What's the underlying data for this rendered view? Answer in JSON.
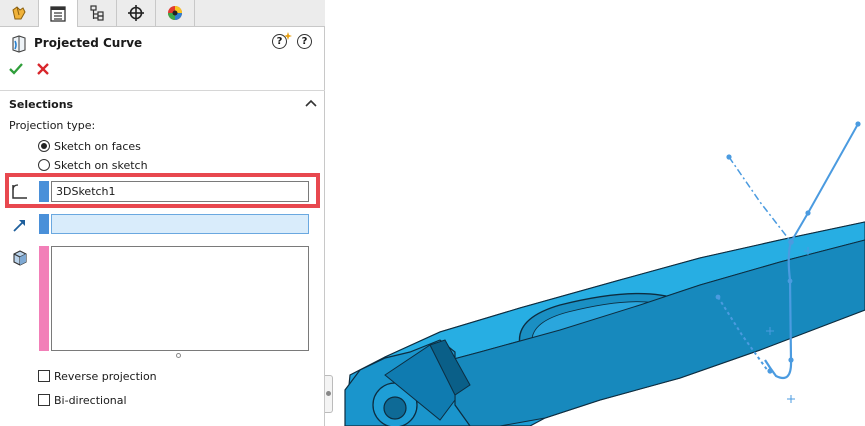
{
  "tabs": [
    {
      "icon": "feature-manager-icon",
      "active": false
    },
    {
      "icon": "property-manager-icon",
      "active": true
    },
    {
      "icon": "configuration-manager-icon",
      "active": false
    },
    {
      "icon": "dimxpert-manager-icon",
      "active": false
    },
    {
      "icon": "display-manager-icon",
      "active": false
    }
  ],
  "header": {
    "title": "Projected Curve",
    "title_icon": "projected-curve-icon",
    "help_label": "?"
  },
  "actions": {
    "ok_icon": "checkmark-icon",
    "cancel_icon": "x-icon"
  },
  "selections": {
    "section_title": "Selections",
    "projection_type_label": "Projection type:",
    "options": [
      "Sketch on faces",
      "Sketch on sketch"
    ],
    "selected_option": "Sketch on faces",
    "sketch_value": "3DSketch1",
    "reverse_label": "Reverse projection",
    "bidirectional_label": "Bi-directional"
  },
  "colors": {
    "sketch_strip": "#4a90d9",
    "faces_strip": "#4a90d9",
    "bodies_strip": "#f27fb8",
    "highlight": "#e8484f",
    "part": "#1e9ed6",
    "sketch_line": "#4b9be0"
  }
}
